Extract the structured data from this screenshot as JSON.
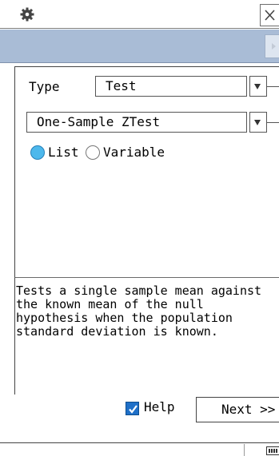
{
  "type_label": "Type",
  "type_value": "Test",
  "test_value": "One-Sample ZTest",
  "radio_list_label": "List",
  "radio_variable_label": "Variable",
  "radio_selected": "List",
  "description": "Tests a single sample mean against the known mean of the null hypothesis when the population standard deviation is known.",
  "help_label": "Help",
  "help_checked": true,
  "next_label": "Next >>",
  "icons": {
    "settings": "gear-icon",
    "close": "close-icon",
    "toolbar": "play-arrow-icon",
    "dropdown": "triangle-down-icon",
    "battery": "battery-icon"
  },
  "colors": {
    "toolbar": "#a9bcd6",
    "radio_selected": "#4db8ec",
    "checkbox": "#1f70c8"
  }
}
